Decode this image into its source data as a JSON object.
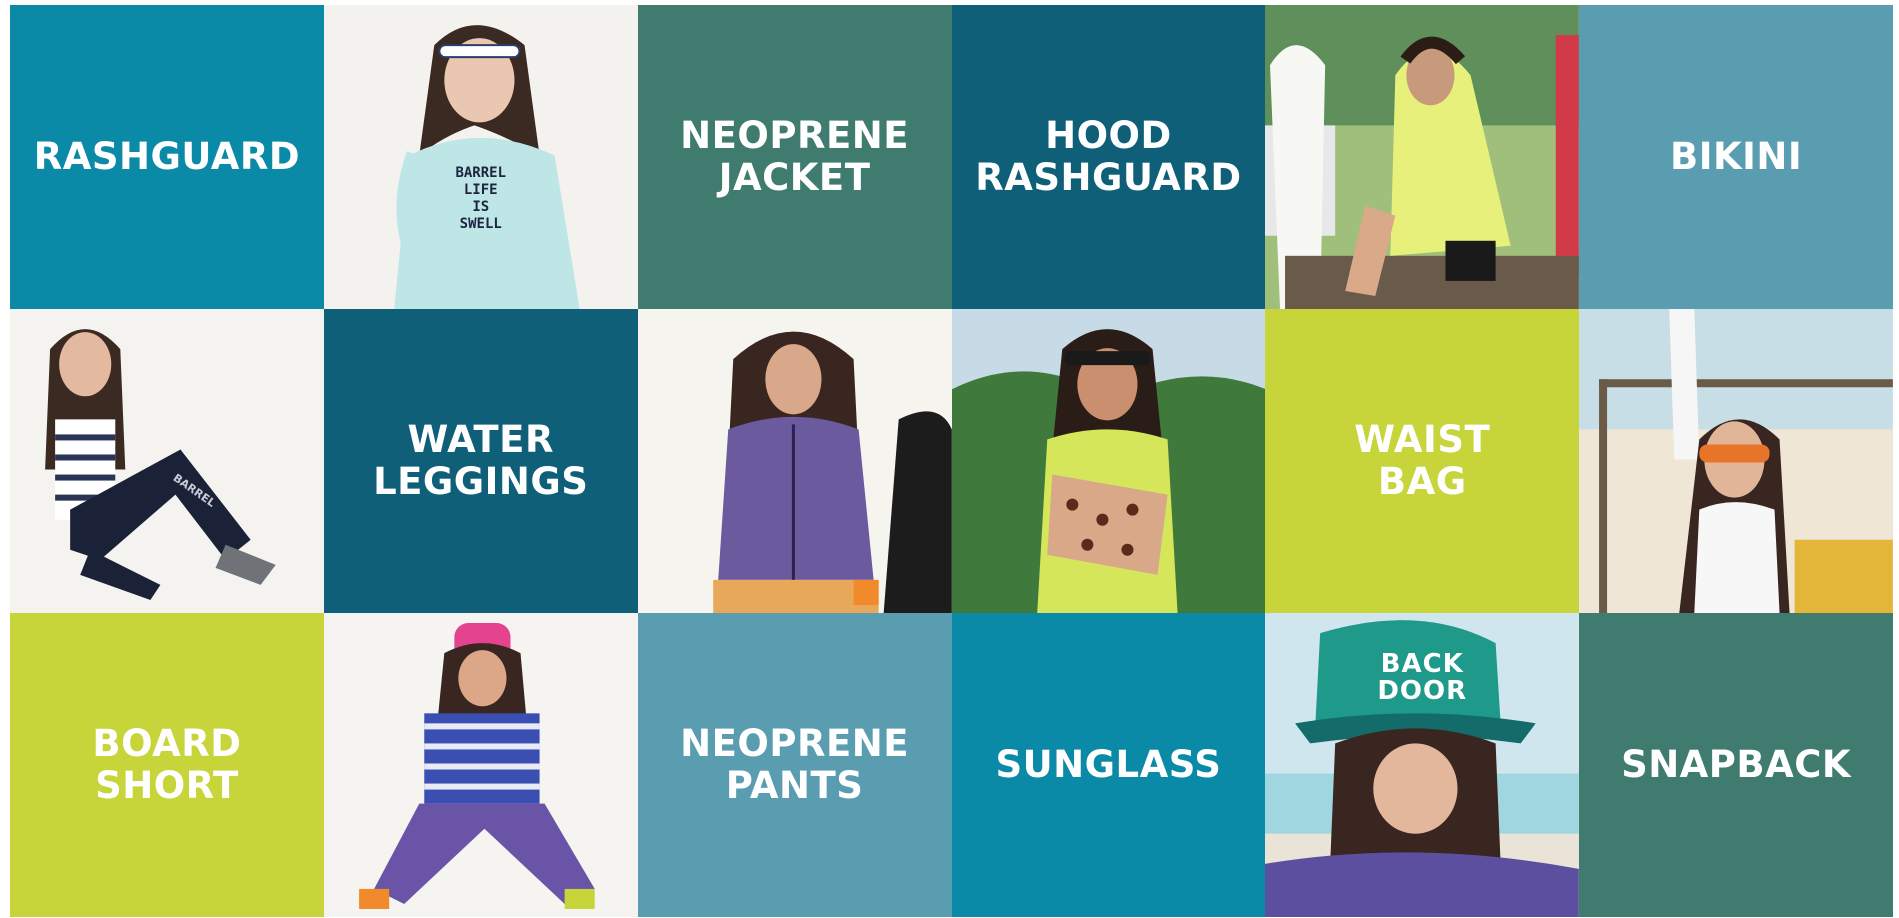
{
  "tiles": [
    {
      "kind": "label",
      "text": "RASHGUARD",
      "color": "#0b8aa8"
    },
    {
      "kind": "photo",
      "icon": "model-photo-rashguard",
      "photo_text": "BARREL\nLIFE\nIS\nSWELL"
    },
    {
      "kind": "label",
      "text": "NEOPRENE\nJACKET",
      "color": "#3f7b6e"
    },
    {
      "kind": "label",
      "text": "HOOD\nRASHGUARD",
      "color": "#0f5f78"
    },
    {
      "kind": "photo",
      "icon": "model-photo-hood-rashguard"
    },
    {
      "kind": "label",
      "text": "BIKINI",
      "color": "#5a9db1"
    },
    {
      "kind": "photo",
      "icon": "model-photo-water-leggings",
      "photo_text": "BARREL"
    },
    {
      "kind": "label",
      "text": "WATER\nLEGGINGS",
      "color": "#0f5f78"
    },
    {
      "kind": "photo",
      "icon": "model-photo-neoprene-jacket"
    },
    {
      "kind": "photo",
      "icon": "model-photo-waist-bag"
    },
    {
      "kind": "label",
      "text": "WAIST\nBAG",
      "color": "#c7d43a"
    },
    {
      "kind": "photo",
      "icon": "model-photo-sunglass"
    },
    {
      "kind": "label",
      "text": "BOARD\nSHORT",
      "color": "#c7d43a"
    },
    {
      "kind": "photo",
      "icon": "model-photo-board-short"
    },
    {
      "kind": "label",
      "text": "NEOPRENE\nPANTS",
      "color": "#5a9db1"
    },
    {
      "kind": "label",
      "text": "SUNGLASS",
      "color": "#0b8aa8"
    },
    {
      "kind": "photo",
      "icon": "model-photo-snapback",
      "photo_text": "BACK\nDOOR"
    },
    {
      "kind": "label",
      "text": "SNAPBACK",
      "color": "#3f7b6e"
    }
  ]
}
